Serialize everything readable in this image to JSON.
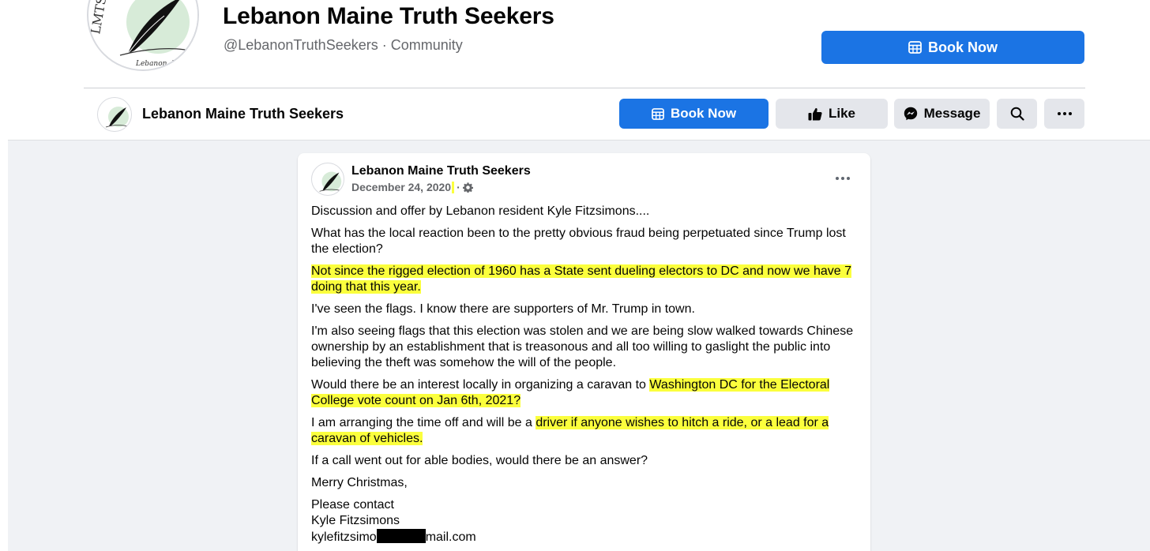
{
  "header": {
    "title": "Lebanon Maine Truth Seekers",
    "subtitle": "@LebanonTruthSeekers · Community",
    "book_now_label": "Book Now",
    "logo_caption": "Lebanon, Maine",
    "logo_letters": "LMTS"
  },
  "subbar": {
    "title": "Lebanon Maine Truth Seekers",
    "book_now_label": "Book Now",
    "like_label": "Like",
    "message_label": "Message"
  },
  "post": {
    "author": "Lebanon Maine Truth Seekers",
    "date": "December 24, 2020",
    "date_separator": "·",
    "paragraphs": {
      "p1": "Discussion and offer by Lebanon resident Kyle Fitzsimons....",
      "p2": "What has the local reaction been to the pretty obvious fraud being perpetuated since Trump lost the election?",
      "p3": "Not since the rigged election of 1960 has a State sent dueling electors to DC and now we have 7 doing that this year.",
      "p4": "I've seen the flags. I know there are supporters of Mr. Trump in town.",
      "p5": "I'm also seeing flags that this election was stolen and we are being slow walked towards Chinese ownership by an establishment that is treasonous and all too willing to gaslight the public into believing the theft was somehow the will of the people.",
      "p6_plain": "Would there be an interest locally in organizing a caravan to",
      "p6_hl": "Washington DC for the Electoral College vote count on Jan 6th, 2021?",
      "p7_plain": "I am arranging the time off and will be a",
      "p7_hl": "driver if anyone wishes to hitch a ride, or a lead for a caravan of vehicles.",
      "p8": "If a call went out for able bodies, would there be an answer?",
      "p9": "Merry Christmas,",
      "p10_line1": "Please contact",
      "p10_line2": "Kyle Fitzsimons",
      "email_prefix": "kylefitzsimo",
      "email_suffix": "mail.com"
    }
  },
  "colors": {
    "primary": "#1b74e4",
    "highlight": "#fbff3d",
    "background": "#f0f2f5",
    "secondary_button": "#e4e6eb"
  },
  "icons": {
    "book": "calendar-grid-icon",
    "like": "thumbs-up-icon",
    "message": "messenger-icon",
    "search": "search-icon",
    "more": "more-dots-icon",
    "audience": "gear-icon"
  }
}
